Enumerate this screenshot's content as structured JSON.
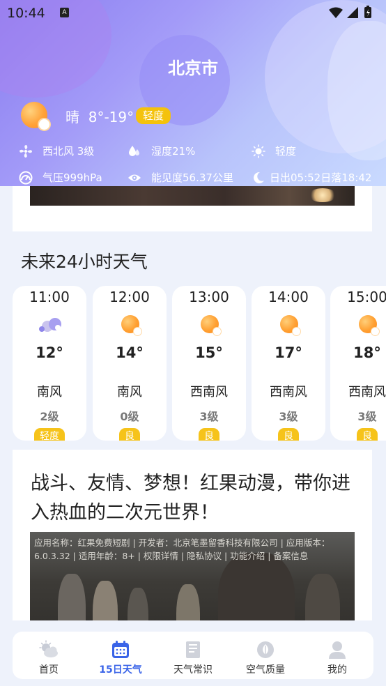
{
  "status_bar": {
    "time": "10:44",
    "notification_badge": "A"
  },
  "header": {
    "city": "北京市",
    "condition": "晴",
    "temp_range": "8°-19°",
    "air_quality": "轻度",
    "details_row1": {
      "wind": "西北风 3级",
      "humidity": "湿度21%",
      "uv": "轻度"
    },
    "details_row2": {
      "pressure": "气压999hPa",
      "visibility": "能见度56.37公里",
      "sun": "日出05:52日落18:42"
    }
  },
  "hourly": {
    "title": "未来24小时天气",
    "items": [
      {
        "time": "11:00",
        "icon": "partly-cloudy-icon",
        "temp": "12°",
        "wind_dir": "南风",
        "wind_level": "2级",
        "aq": "轻度"
      },
      {
        "time": "12:00",
        "icon": "sunny-icon",
        "temp": "14°",
        "wind_dir": "南风",
        "wind_level": "0级",
        "aq": "良"
      },
      {
        "time": "13:00",
        "icon": "sunny-icon",
        "temp": "15°",
        "wind_dir": "西南风",
        "wind_level": "3级",
        "aq": "良"
      },
      {
        "time": "14:00",
        "icon": "sunny-icon",
        "temp": "17°",
        "wind_dir": "西南风",
        "wind_level": "3级",
        "aq": "良"
      },
      {
        "time": "15:00",
        "icon": "sunny-icon",
        "temp": "18°",
        "wind_dir": "西南风",
        "wind_level": "3级",
        "aq": "良"
      }
    ]
  },
  "article": {
    "headline": "战斗、友情、梦想！红果动漫，带你进入热血的二次元世界！",
    "meta": "应用名称：红果免费短剧 | 开发者：北京笔墨留香科技有限公司 | 应用版本：6.0.3.32 | 适用年龄：8+ | 权限详情 | 隐私协议 | 功能介绍 | 备案信息"
  },
  "nav": {
    "items": [
      {
        "label": "首页",
        "icon": "home-weather-icon",
        "active": false
      },
      {
        "label": "15日天气",
        "icon": "calendar-icon",
        "active": true
      },
      {
        "label": "天气常识",
        "icon": "book-icon",
        "active": false
      },
      {
        "label": "空气质量",
        "icon": "leaf-icon",
        "active": false
      },
      {
        "label": "我的",
        "icon": "user-icon",
        "active": false
      }
    ]
  },
  "colors": {
    "accent": "#3a64e8",
    "aq_badge": "#f4c20d",
    "header_gradient_start": "#8a7df0",
    "header_gradient_end": "#c9daff"
  }
}
